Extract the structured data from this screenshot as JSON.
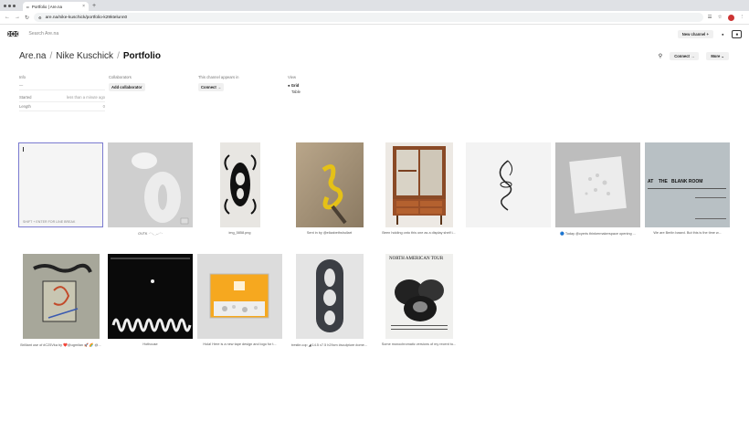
{
  "browser": {
    "tab_title": "Portfolio | Are.na",
    "url": "are.na/nike-kuschick/portfolio-k29ktelunn0"
  },
  "header": {
    "search_placeholder": "Search Are.na",
    "new_channel_label": "New channel +"
  },
  "breadcrumb": {
    "root": "Are.na",
    "user": "Nike Kuschick",
    "channel": "Portfolio"
  },
  "actions": {
    "connect_label": "Connect →",
    "more_label": "More ⌄"
  },
  "meta": {
    "info_heading": "Info",
    "info_dash": "—",
    "rows": [
      {
        "label": "Started",
        "value": "less than a minute ago"
      },
      {
        "label": "Length",
        "value": "0"
      }
    ],
    "collaborators_heading": "Collaborators",
    "add_collaborator_label": "Add collaborator",
    "appears_heading": "This channel appears in",
    "appears_connect_label": "Connect →",
    "view_heading": "View",
    "view_grid": "● Grid",
    "view_table": "Table"
  },
  "editor_hint": "SHIFT + ENTER FOR LINE BREAK",
  "blocks": [
    {
      "caption": "OVTK ·⁻·˗ˏˎ‐˗·⁻·"
    },
    {
      "caption": "img_5858.png"
    },
    {
      "caption": "Sent in by @elizabethshullart"
    },
    {
      "caption": "Been holding onto this one as a display shelf i..."
    },
    {
      "caption": ""
    },
    {
      "caption": "🔵 Today @cyeris thinkermakerspace opening ..."
    },
    {
      "caption": "We are Berlin based. But this is the time w..."
    },
    {
      "caption": "Brilliant use of #C25Vka by ❤️@ugmilan 🚀 🌈 @..."
    },
    {
      "caption": "Hothouse"
    },
    {
      "caption": "Hola! Here is a new tape design and logo for t..."
    },
    {
      "caption": "trestle.cop ◢ 14.5 x7.5 h29cm #sculpture #ome..."
    },
    {
      "caption": "Some monochromatic versions of my recent to..."
    }
  ],
  "poster_blank_room": {
    "line1": "AT    THE   BLANK ROOM"
  },
  "poster_tour": {
    "title": "NORTH AMERICAN TOUR"
  }
}
